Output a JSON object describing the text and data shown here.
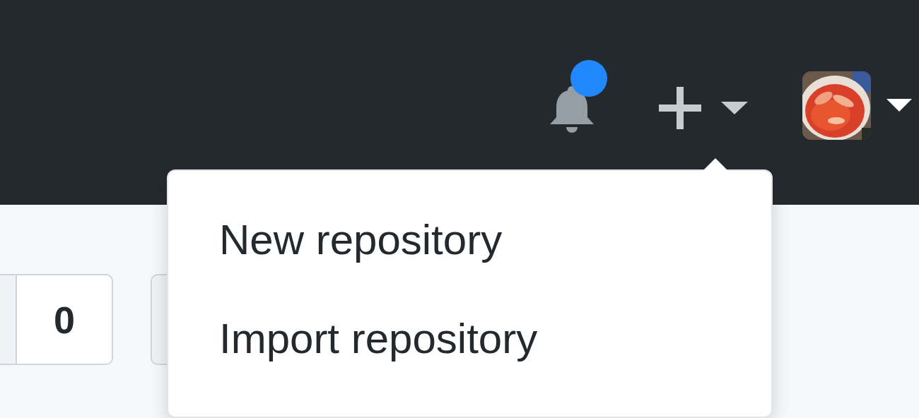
{
  "header": {
    "notifications": {
      "unread": true
    },
    "create_menu": {
      "expanded": true
    }
  },
  "dropdown": {
    "items": [
      {
        "label": "New repository"
      },
      {
        "label": "Import repository"
      }
    ]
  },
  "counter": {
    "value": "0"
  }
}
